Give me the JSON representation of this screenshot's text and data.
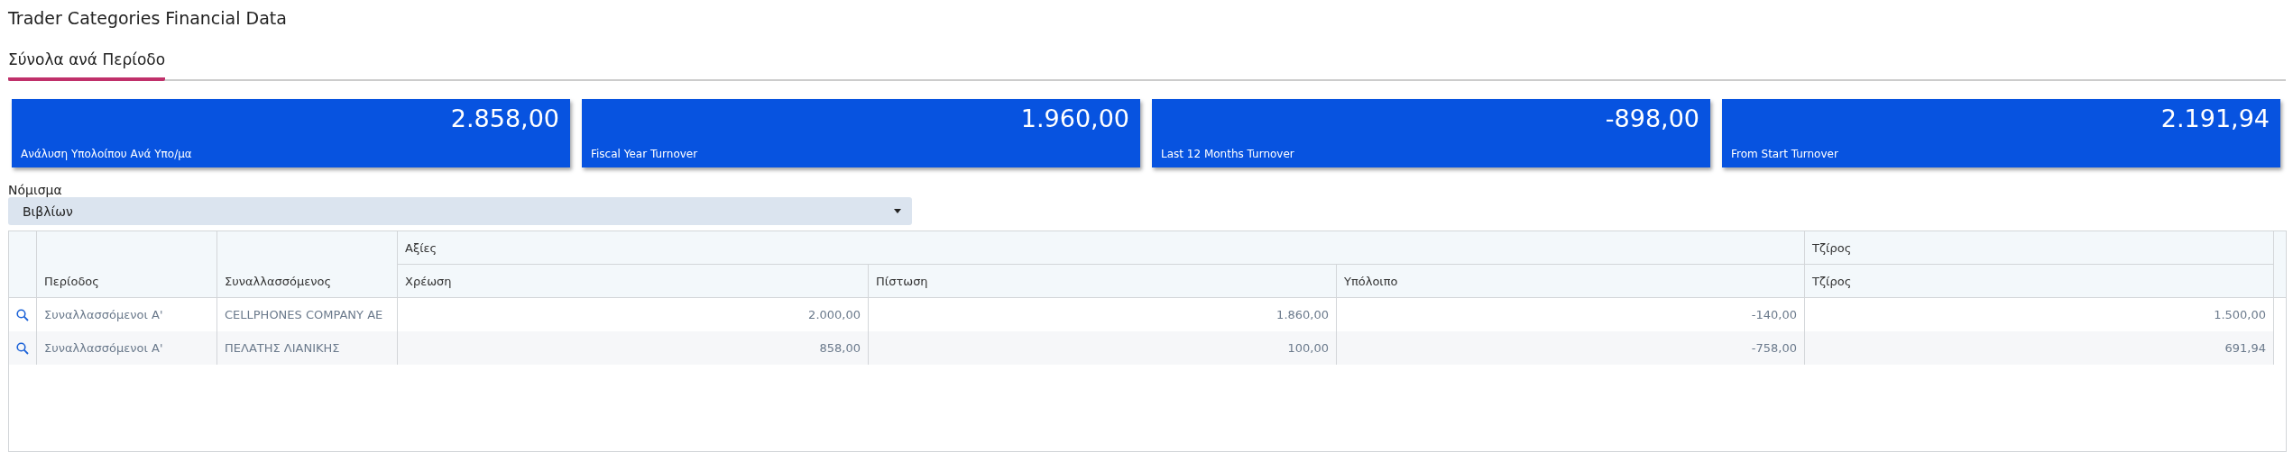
{
  "page_title": "Trader Categories Financial Data",
  "tabs": [
    {
      "label": "Σύνολα ανά Περίοδο",
      "selected": true
    }
  ],
  "cards": [
    {
      "value": "2.858,00",
      "label": "Ανάλυση Υπολοίπου Ανά Υπο/μα"
    },
    {
      "value": "1.960,00",
      "label": "Fiscal Year Turnover"
    },
    {
      "value": "-898,00",
      "label": "Last 12 Months Turnover"
    },
    {
      "value": "2.191,94",
      "label": "From Start Turnover"
    }
  ],
  "currency": {
    "label": "Νόμισμα",
    "value": "Βιβλίων"
  },
  "table": {
    "columns": [
      "Περίοδος",
      "Συναλλασσόμενος"
    ],
    "groups": [
      {
        "label": "Αξίες",
        "columns": [
          "Χρέωση",
          "Πίστωση",
          "Υπόλοιπο"
        ]
      },
      {
        "label": "Τζίρος",
        "columns": [
          "Τζίρος"
        ]
      }
    ],
    "rows": [
      [
        "Συναλλασσόμενοι Α'",
        "CELLPHONES COMPANY AE",
        "2.000,00",
        "1.860,00",
        "-140,00",
        "1.500,00"
      ],
      [
        "Συναλλασσόμενοι Α'",
        "ΠΕΛΑΤΗΣ ΛΙΑΝΙΚΗΣ",
        "858,00",
        "100,00",
        "-758,00",
        "691,94"
      ]
    ]
  }
}
